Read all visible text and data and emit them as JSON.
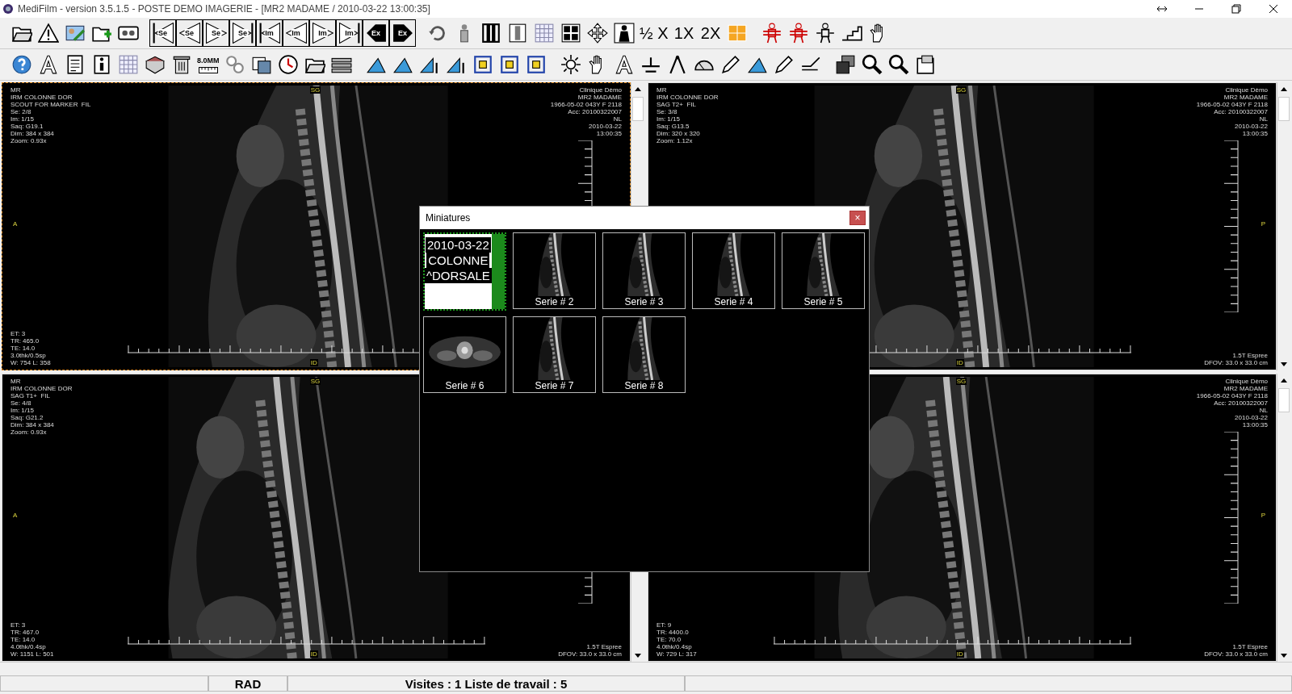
{
  "window": {
    "title": "MediFilm - version 3.5.1.5  - POSTE DEMO IMAGERIE - [MR2 MADAME / 2010-03-22 13:00:35]"
  },
  "toolbars": [
    [
      [
        {
          "kind": "folder"
        },
        {
          "kind": "warning"
        },
        {
          "kind": "id-card"
        },
        {
          "kind": "folder-plus"
        },
        {
          "kind": "cassette"
        }
      ],
      [
        {
          "kind": "first",
          "label": "Se"
        },
        {
          "kind": "prev",
          "label": "Se"
        },
        {
          "kind": "next",
          "label": "Se"
        },
        {
          "kind": "last",
          "label": "Se"
        },
        {
          "kind": "first",
          "label": "Im"
        },
        {
          "kind": "prev",
          "label": "Im"
        },
        {
          "kind": "next",
          "label": "Im"
        },
        {
          "kind": "last",
          "label": "Im"
        },
        {
          "kind": "prev-dark",
          "label": "Ex"
        },
        {
          "kind": "next-dark",
          "label": "Ex"
        }
      ],
      [
        {
          "kind": "rotate"
        },
        {
          "kind": "person"
        },
        {
          "kind": "columns"
        },
        {
          "kind": "column-split"
        },
        {
          "kind": "grid"
        },
        {
          "kind": "people-grid"
        },
        {
          "kind": "move"
        },
        {
          "kind": "skeleton"
        },
        {
          "kind": "text",
          "label": "½ X"
        },
        {
          "kind": "text",
          "label": "1X"
        },
        {
          "kind": "text",
          "label": "2X"
        },
        {
          "kind": "tile-grid"
        }
      ],
      [
        {
          "kind": "figure-lines"
        },
        {
          "kind": "figure-lines"
        },
        {
          "kind": "figure"
        },
        {
          "kind": "steps"
        },
        {
          "kind": "hand"
        }
      ]
    ],
    [
      [
        {
          "kind": "help"
        },
        {
          "kind": "font"
        },
        {
          "kind": "document"
        },
        {
          "kind": "info"
        },
        {
          "kind": "grid"
        },
        {
          "kind": "book"
        },
        {
          "kind": "trash"
        },
        {
          "kind": "ruler",
          "label": "8.0MM"
        },
        {
          "kind": "gears"
        },
        {
          "kind": "images"
        },
        {
          "kind": "clock"
        },
        {
          "kind": "folder"
        },
        {
          "kind": "bars"
        }
      ],
      [
        {
          "kind": "angle"
        },
        {
          "kind": "angle"
        },
        {
          "kind": "arrow-angle"
        },
        {
          "kind": "arrow-angle"
        },
        {
          "kind": "square"
        },
        {
          "kind": "square"
        },
        {
          "kind": "square"
        }
      ],
      [
        {
          "kind": "sun"
        },
        {
          "kind": "hand"
        },
        {
          "kind": "font"
        },
        {
          "kind": "plus-line"
        },
        {
          "kind": "compass"
        },
        {
          "kind": "protractor"
        },
        {
          "kind": "pencil"
        },
        {
          "kind": "angle"
        },
        {
          "kind": "pencil"
        },
        {
          "kind": "measure"
        }
      ],
      [
        {
          "kind": "windows"
        },
        {
          "kind": "search"
        },
        {
          "kind": "search"
        },
        {
          "kind": "panel"
        }
      ]
    ]
  ],
  "viewports": [
    {
      "selected": true,
      "top_left": [
        "MR",
        "IRM COLONNE DOR",
        "SCOUT FOR MARKER  FIL",
        "Se: 2/8",
        "Im: 1/15",
        "Saq: G19.1",
        "Dim: 384 x 384",
        "Zoom: 0.93x"
      ],
      "top_right": [
        "Clinique Dèmo",
        "MR2 MADAME",
        "1966-05-02 043Y F 2118",
        "Acc: 20100322007",
        "NL",
        "2010-03-22",
        "13:00:35"
      ],
      "bottom_left": [
        "ET: 3",
        "TR: 465.0",
        "TE: 14.0",
        "3.0thk/0.5sp",
        "W: 754 L: 358"
      ],
      "top_marker": "SG",
      "bottom_marker": "ID",
      "left_marker": "A"
    },
    {
      "selected": false,
      "top_left": [
        "MR",
        "IRM COLONNE DOR",
        "SAG T2+  FIL",
        "Se: 3/8",
        "Im: 1/15",
        "Saq: G13.5",
        "Dim: 320 x 320",
        "Zoom: 1.12x"
      ],
      "top_right": [
        "Clinique Dèmo",
        "MR2 MADAME",
        "1966-05-02 043Y F 2118",
        "Acc: 20100322007",
        "NL",
        "2010-03-22",
        "13:00:35"
      ],
      "bottom_right": [
        "1.5T Espree",
        "DFOV: 33.0 x 33.0 cm"
      ],
      "top_marker": "SG",
      "bottom_marker": "ID",
      "right_marker": "P"
    },
    {
      "selected": false,
      "top_left": [
        "MR",
        "IRM COLONNE DOR",
        "SAG T1+  FIL",
        "Se: 4/8",
        "Im: 1/15",
        "Saq: G21.2",
        "Dim: 384 x 384",
        "Zoom: 0.93x"
      ],
      "bottom_left": [
        "ET: 3",
        "TR: 467.0",
        "TE: 14.0",
        "4.0thk/0.4sp",
        "W: 1151 L: 501"
      ],
      "bottom_right": [
        "1.5T Espree",
        "DFOV: 33.0 x 33.0 cm"
      ],
      "top_marker": "SG",
      "bottom_marker": "ID",
      "left_marker": "A"
    },
    {
      "selected": false,
      "top_right": [
        "Clinique Dèmo",
        "MR2 MADAME",
        "1966-05-02 043Y F 2118",
        "Acc: 20100322007",
        "NL",
        "2010-03-22",
        "13:00:35"
      ],
      "bottom_left": [
        "ET: 9",
        "TR: 4400.0",
        "TE: 70.0",
        "4.0thk/0.4sp",
        "W: 729 L: 317"
      ],
      "bottom_right": [
        "1.5T Espree",
        "DFOV: 33.0 x 33.0 cm"
      ],
      "top_marker": "SG",
      "bottom_marker": "ID",
      "right_marker": "P"
    }
  ],
  "dialog": {
    "title": "Miniatures",
    "close": "×",
    "thumbnails": [
      {
        "kind": "title",
        "selected": true,
        "lines": [
          "2010-03-22",
          "COLONNE",
          "^DORSALE"
        ]
      },
      {
        "kind": "series",
        "selected": false,
        "label": "Serie # 2"
      },
      {
        "kind": "series",
        "selected": false,
        "label": "Serie # 3"
      },
      {
        "kind": "series",
        "selected": false,
        "label": "Serie # 4"
      },
      {
        "kind": "series",
        "selected": false,
        "label": "Serie # 5"
      },
      {
        "kind": "axial",
        "selected": false,
        "label": "Serie # 6"
      },
      {
        "kind": "series",
        "selected": false,
        "label": "Serie # 7"
      },
      {
        "kind": "series",
        "selected": false,
        "label": "Serie # 8"
      }
    ]
  },
  "status_bar": [
    "RAD",
    "Visites : 1  Liste de travail : 5"
  ]
}
